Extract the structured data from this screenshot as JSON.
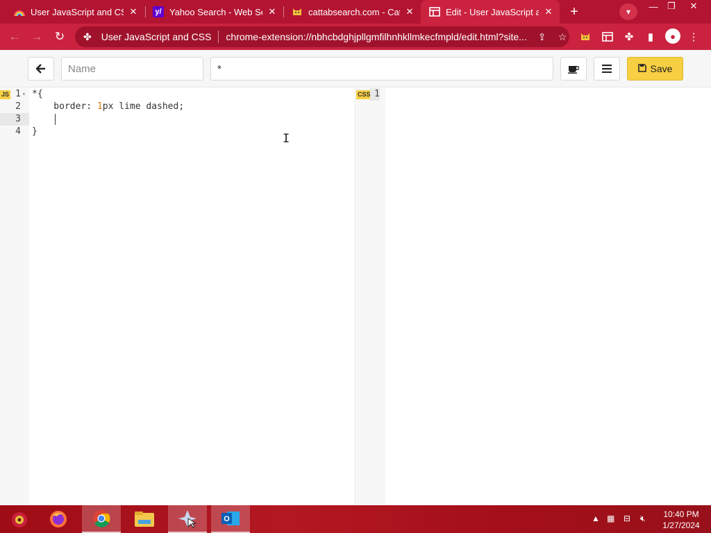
{
  "browser": {
    "tabs": [
      {
        "title": "User JavaScript and CSS",
        "icon": "rainbow-icon",
        "active": false
      },
      {
        "title": "Yahoo Search - Web Sear",
        "icon": "yahoo-icon",
        "active": false
      },
      {
        "title": "cattabsearch.com - Catta",
        "icon": "cat-icon",
        "active": false
      },
      {
        "title": "Edit - User JavaScript and",
        "icon": "table-icon",
        "active": true
      }
    ],
    "address": {
      "site_name": "User JavaScript and CSS",
      "url": "chrome-extension://nbhcbdghjpllgmfilhnhkllmkecfmpld/edit.html?site..."
    },
    "accent_color": "#cb2240"
  },
  "editor_page": {
    "name_placeholder": "Name",
    "pattern_value": "*",
    "save_label": "Save",
    "js_badge": "JS",
    "css_badge": "CSS",
    "js_lines": [
      {
        "num": "1",
        "code": "*{"
      },
      {
        "num": "2",
        "code_prefix": "    border: ",
        "code_number": "1",
        "code_suffix": "px lime dashed;"
      },
      {
        "num": "3",
        "code": ""
      },
      {
        "num": "4",
        "code": "}"
      }
    ],
    "css_lines": [
      {
        "num": "1",
        "code": ""
      }
    ]
  },
  "taskbar": {
    "apps": [
      "spider-tree-icon",
      "firefox-icon",
      "chrome-icon",
      "file-explorer-icon",
      "window-switcher-icon",
      "outlook-icon"
    ],
    "clock_time": "10:40 PM",
    "clock_date": "1/27/2024"
  }
}
